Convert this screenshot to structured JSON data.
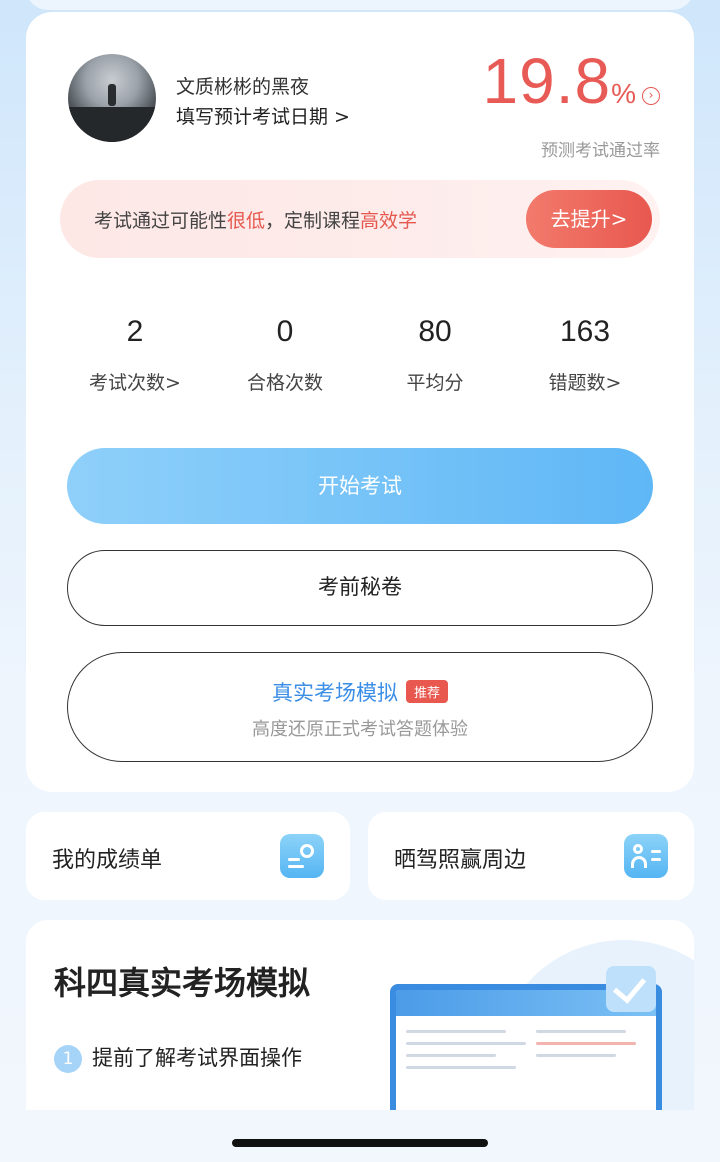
{
  "profile": {
    "username": "文质彬彬的黑夜",
    "date_link": "填写预计考试日期 >"
  },
  "pass_rate": {
    "value": "19.8",
    "unit": "%",
    "label": "预测考试通过率",
    "color": "#e85a55"
  },
  "promo": {
    "text_a": "考试通过可能性",
    "text_red1": "很低",
    "text_b": "，定制课程",
    "text_red2": "高效学",
    "button": "去提升>"
  },
  "stats": [
    {
      "value": "2",
      "label": "考试次数>"
    },
    {
      "value": "0",
      "label": "合格次数"
    },
    {
      "value": "80",
      "label": "平均分"
    },
    {
      "value": "163",
      "label": "错题数>"
    }
  ],
  "buttons": {
    "start": "开始考试",
    "secret": "考前秘卷",
    "sim_title": "真实考场模拟",
    "sim_badge": "推荐",
    "sim_sub": "高度还原正式考试答题体验"
  },
  "shortcuts": {
    "scores": "我的成绩单",
    "license": "晒驾照赢周边"
  },
  "section": {
    "title": "科四真实考场模拟",
    "step_num": "1",
    "step_text": "提前了解考试界面操作"
  },
  "colors": {
    "accent_blue": "#5fb7f6",
    "accent_red": "#e8584f"
  }
}
